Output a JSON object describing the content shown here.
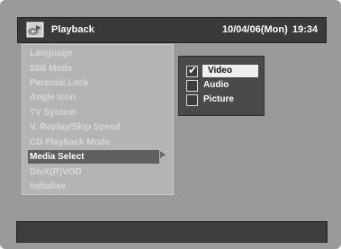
{
  "header": {
    "title": "Playback",
    "date": "10/04/06(Mon)",
    "time": "19:34",
    "icon": "playback-disc-icon"
  },
  "menu": {
    "items": [
      {
        "label": "Language"
      },
      {
        "label": "Still Mode"
      },
      {
        "label": "Parental Lock"
      },
      {
        "label": "Angle Icon"
      },
      {
        "label": "TV System"
      },
      {
        "label": "V. Replay/Skip Speed"
      },
      {
        "label": "CD Playback Mode"
      },
      {
        "label": "Media Select",
        "selected": true
      },
      {
        "label": "DivX(R)VOD"
      },
      {
        "label": "Initialise"
      }
    ]
  },
  "submenu": {
    "options": [
      {
        "label": "Video",
        "checked": true,
        "selected": true
      },
      {
        "label": "Audio",
        "checked": false
      },
      {
        "label": "Picture",
        "checked": false
      }
    ]
  },
  "colors": {
    "background": "#9a9a9a",
    "header": "#3a3a3a",
    "menu_panel": "#b4b4b4",
    "menu_selected": "#5f5f5f",
    "submenu_panel": "#4a4a4a"
  }
}
